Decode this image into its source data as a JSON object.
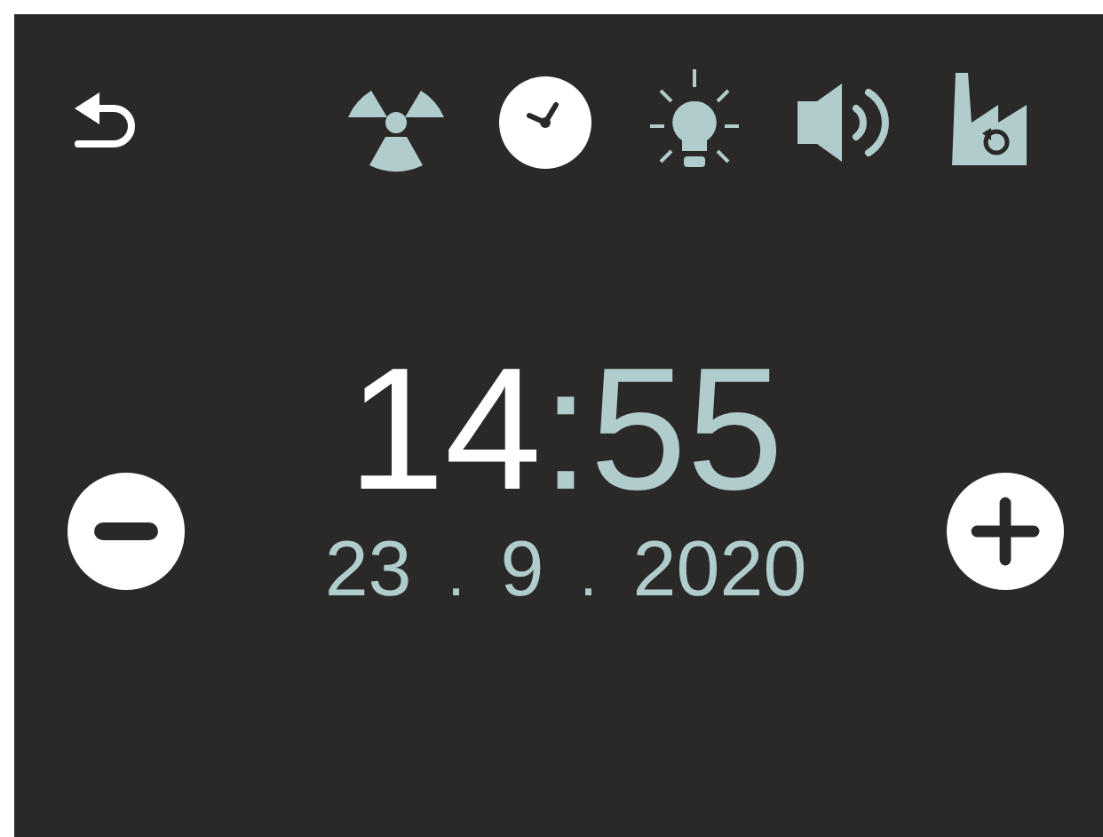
{
  "toolbar": {
    "back": {
      "kind": "back"
    },
    "icons": [
      {
        "kind": "radiation",
        "selected": false
      },
      {
        "kind": "clock",
        "selected": true
      },
      {
        "kind": "light",
        "selected": false
      },
      {
        "kind": "sound",
        "selected": false
      },
      {
        "kind": "factory",
        "selected": false
      }
    ]
  },
  "time": {
    "hours": {
      "text": "14",
      "selected": true
    },
    "separator": ":",
    "minutes": {
      "text": "55",
      "selected": false
    }
  },
  "date": [
    {
      "kind": "value",
      "text": "23"
    },
    {
      "kind": "separator",
      "text": "."
    },
    {
      "kind": "value",
      "text": "9"
    },
    {
      "kind": "separator",
      "text": "."
    },
    {
      "kind": "value",
      "text": "2020"
    }
  ],
  "controls": [
    {
      "kind": "decrease"
    },
    {
      "kind": "increase"
    }
  ]
}
